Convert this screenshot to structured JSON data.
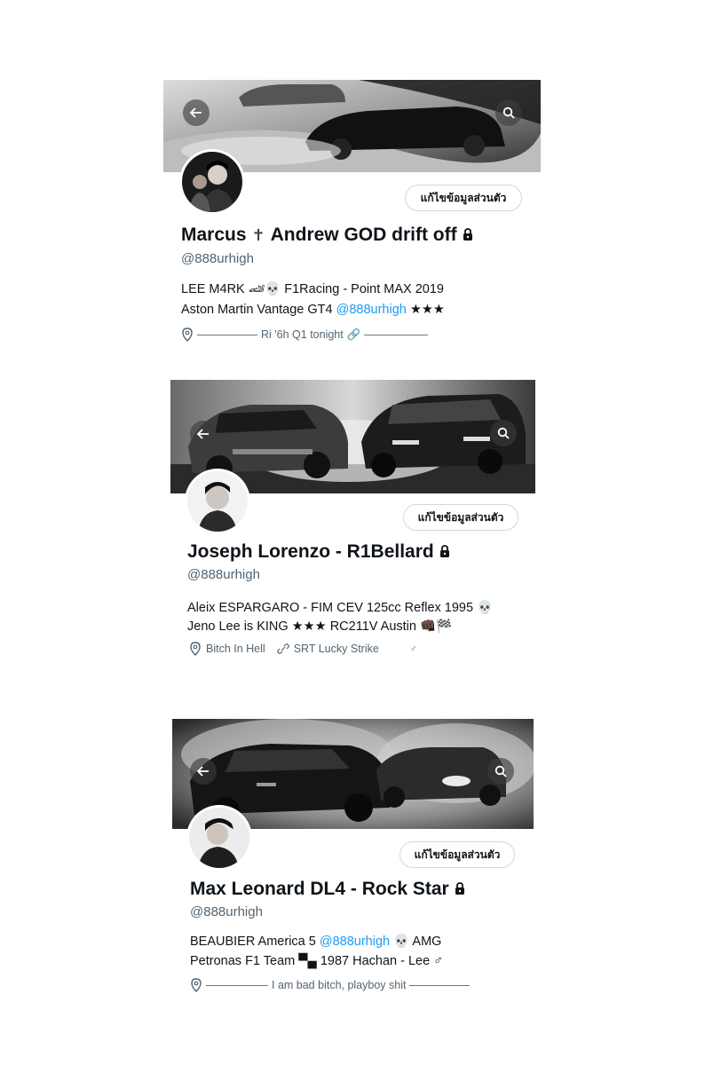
{
  "common": {
    "edit_profile_label": "แก้ไขข้อมูลส่วนตัว"
  },
  "profiles": [
    {
      "name_part1": "Marcus",
      "name_cross": "✝",
      "name_part2": "Andrew GOD drift off",
      "handle": "@888urhigh",
      "bio_line1": "LEE M4RK 🏎💀 F1Racing - Point MAX 2019",
      "bio_line2_text": "Aston Martin Vantage GT4 ",
      "bio_line2_mention": "@888urhigh",
      "bio_line2_tail": " ★★★",
      "meta_text": "Ri '6h Q1 tonight",
      "meta_link_icon": "🔗"
    },
    {
      "name": "Joseph Lorenzo - R1Bellard",
      "handle": "@888urhigh",
      "bio_line1": "Aleix ESPARGARO - FIM CEV 125cc Reflex 1995 💀",
      "bio_line2": "Jeno Lee is KING ★★★ RC211V Austin 👊🏿🏁",
      "location": "Bitch In Hell",
      "link": "SRT Lucky Strike",
      "tail_icon": "♂"
    },
    {
      "name": "Max Leonard DL4 - Rock Star",
      "handle": "@888urhigh",
      "bio_line1_text": "BEAUBIER America 5 ",
      "bio_line1_mention": "@888urhigh",
      "bio_line1_tail": " 💀 AMG",
      "bio_line2": "Petronas F1 Team ▀▄ 1987 Hachan - Lee ♂",
      "meta_text": "I am bad bitch, playboy shit"
    }
  ]
}
